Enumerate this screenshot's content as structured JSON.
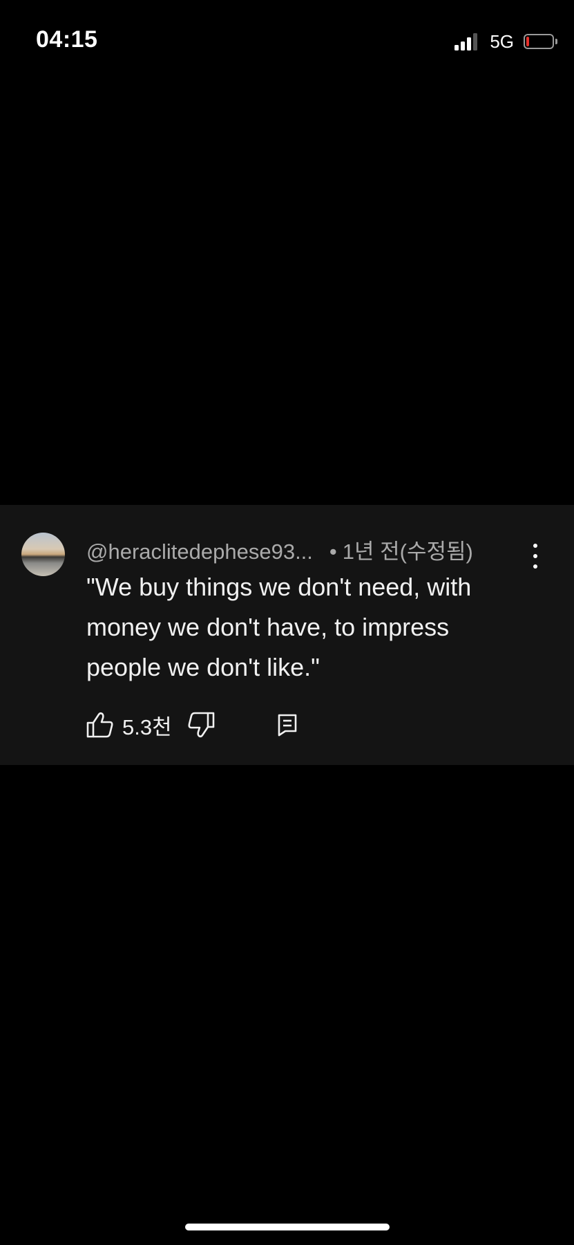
{
  "status_bar": {
    "time": "04:15",
    "network": "5G",
    "signal_bars_active": 3,
    "signal_bars_total": 4,
    "battery_level": 0.1,
    "battery_color": "#e5302a"
  },
  "comment": {
    "author": "@heraclitedephese93...",
    "separator": "•",
    "timestamp": "1년 전(수정됨)",
    "text": "\"We buy things we don't need, with money we don't have, to impress people we don't like.\"",
    "like_count": "5.3천",
    "icons": {
      "more": "more-vertical-icon",
      "like": "thumbs-up-icon",
      "dislike": "thumbs-down-icon",
      "reply": "reply-comment-icon"
    }
  },
  "colors": {
    "background": "#000000",
    "card_background": "#141414",
    "secondary_text": "#aaaaaa",
    "primary_text": "#f1f1f1"
  }
}
